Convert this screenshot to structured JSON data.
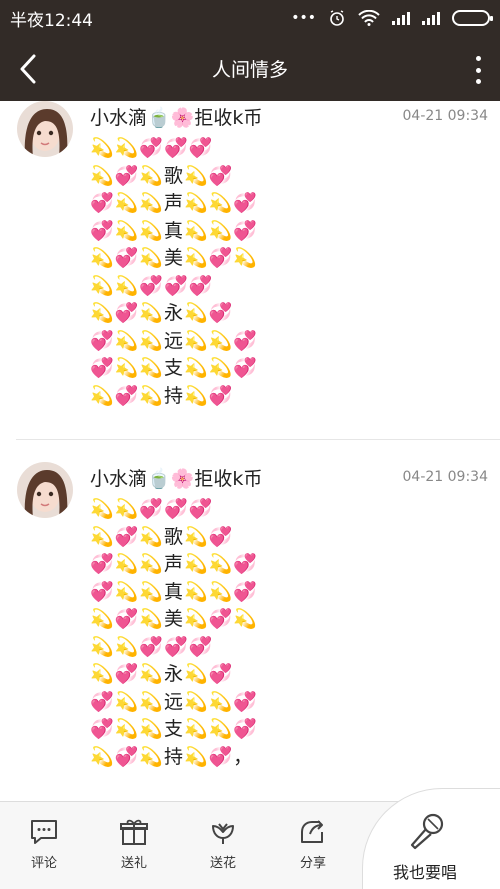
{
  "status_bar": {
    "time": "半夜12:44",
    "dots": "•••"
  },
  "header": {
    "title": "人间情多",
    "back_icon": "chevron-left-icon",
    "more_icon": "vertical-dots-icon"
  },
  "comments": [
    {
      "user": "小水滴🍵🌸拒收k币",
      "date": "04-21 09:34",
      "text": "💫💫💞💞💞\n💫💞💫歌💫💞\n💞💫💫声💫💫💞\n💞💫💫真💫💫💞\n💫💞💫美💫💞💫\n💫💫💞💞💞\n💫💞💫永💫💞\n💞💫💫远💫💫💞\n💞💫💫支💫💫💞\n💫💞💫持💫💞"
    },
    {
      "user": "小水滴🍵🌸拒收k币",
      "date": "04-21 09:34",
      "text": "💫💫💞💞💞\n💫💞💫歌💫💞\n💞💫💫声💫💫💞\n💞💫💫真💫💫💞\n💫💞💫美💫💞💫\n💫💫💞💞💞\n💫💞💫永💫💞\n💞💫💫远💫💫💞\n💞💫💫支💫💫💞\n💫💞💫持💫💞，"
    }
  ],
  "bottom_bar": {
    "comment": "评论",
    "gift": "送礼",
    "flower": "送花",
    "share": "分享",
    "sing": "我也要唱"
  },
  "colors": {
    "header_bg": "#322b27",
    "bottom_bg": "#f7f7f7"
  }
}
